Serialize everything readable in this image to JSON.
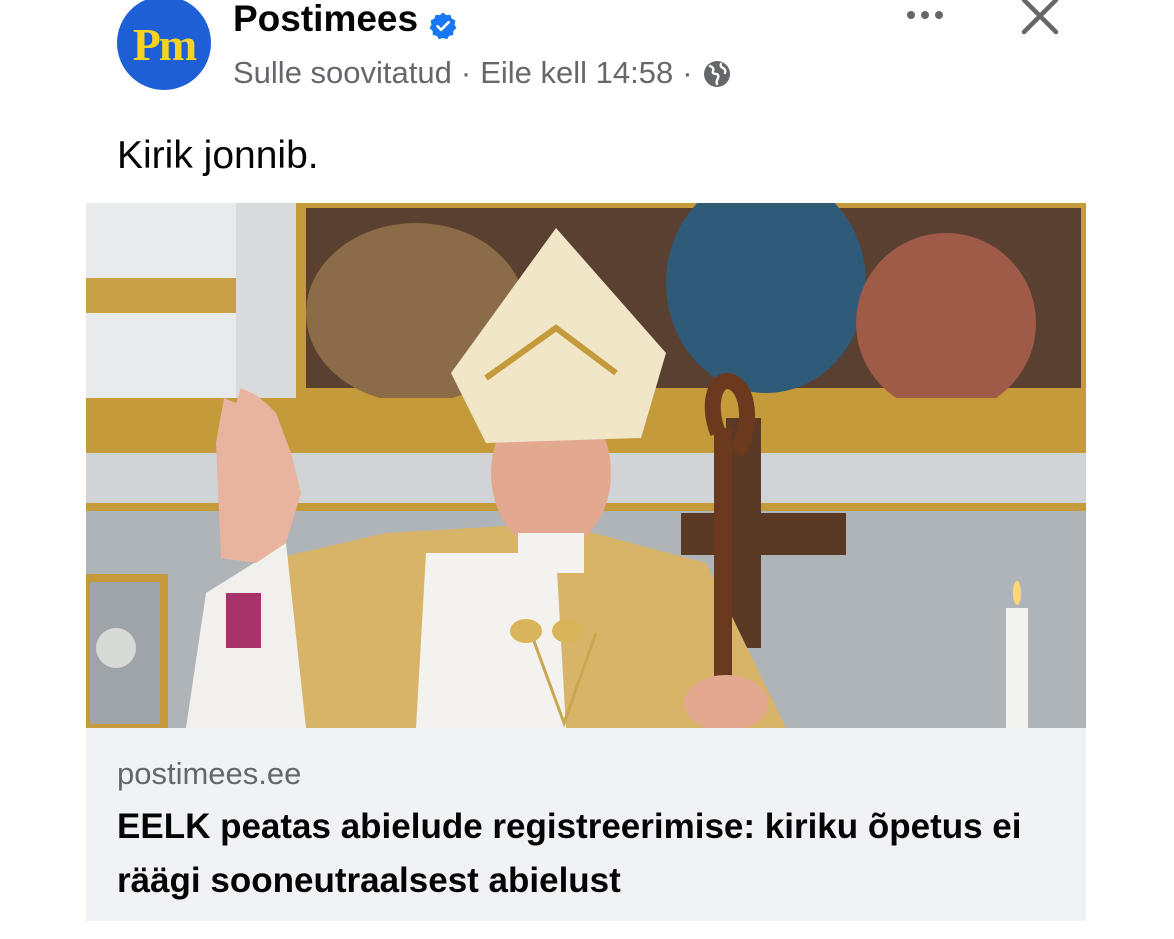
{
  "post": {
    "page_name": "Postimees",
    "avatar_text": "Pm",
    "recommended": "Sulle soovitatud",
    "separator": "·",
    "time": "Eile kell 14:58",
    "text": "Kirik jonnib."
  },
  "link": {
    "domain": "postimees.ee",
    "headline": "EELK peatas abielude registreerimise: kiriku õpetus ei räägi sooneutraalsest abielust"
  },
  "icons": {
    "verified": "verified-badge-icon",
    "globe": "globe-icon",
    "more": "more-options-icon",
    "close": "close-icon"
  },
  "colors": {
    "brand_avatar": "#1f5fd6",
    "avatar_text": "#f5d320",
    "verified": "#1877f2",
    "secondary_text": "#65676b",
    "footer_bg": "#f0f2f5"
  }
}
